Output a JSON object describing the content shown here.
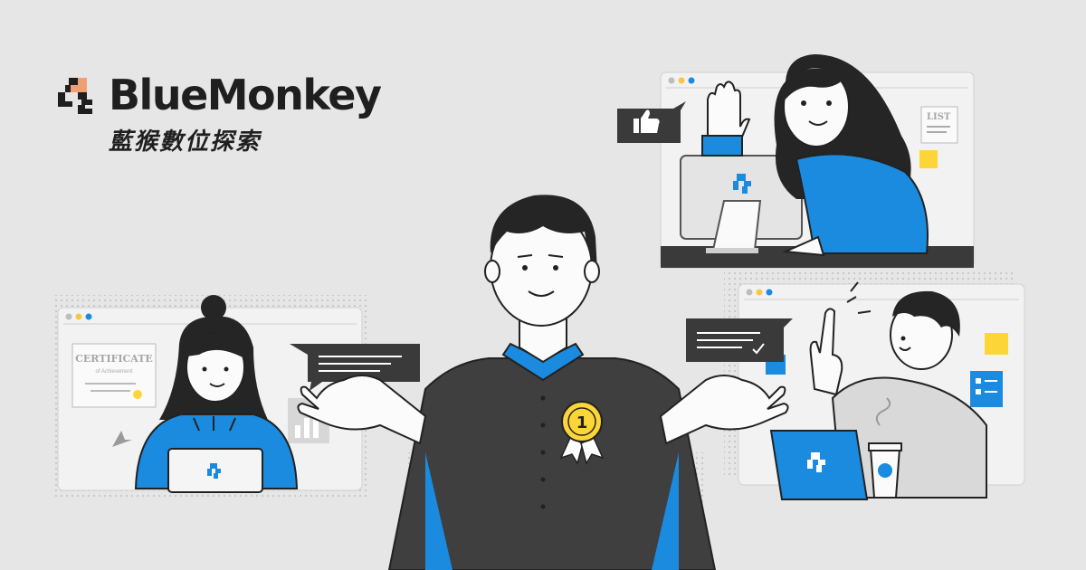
{
  "brand": {
    "name": "BlueMonkey",
    "subtitle": "藍猴數位探索"
  },
  "scene": {
    "certificate_title": "CERTIFICATE",
    "certificate_subtitle": "of Achievement",
    "list_label": "LIST",
    "badge_number": "1"
  },
  "colors": {
    "background": "#e6e6e6",
    "accent_blue": "#1a8bdf",
    "dark": "#2b2b2b",
    "yellow": "#fcd638",
    "window_dot_gray": "#bdbdbd",
    "window_dot_yellow": "#f7c744",
    "window_dot_blue": "#1a8bdf"
  },
  "icons": [
    "bluemonkey-logo-icon",
    "thumbs-up-icon",
    "check-icon",
    "award-badge-icon",
    "cursor-arrow-icon",
    "bar-chart-icon"
  ]
}
